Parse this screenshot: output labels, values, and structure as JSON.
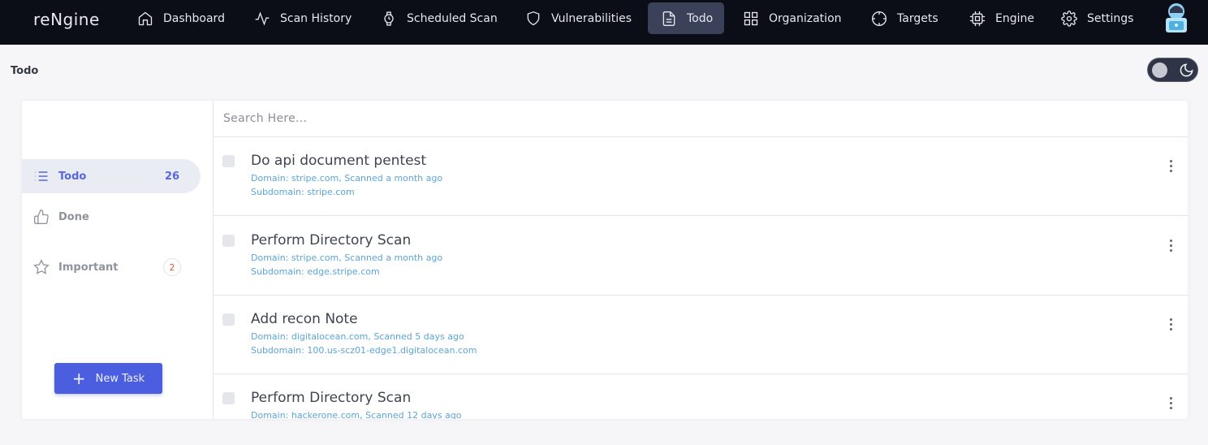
{
  "brand": "reNgine",
  "nav": {
    "items": [
      {
        "label": "Dashboard",
        "icon": "home-icon"
      },
      {
        "label": "Scan History",
        "icon": "activity-icon"
      },
      {
        "label": "Scheduled Scan",
        "icon": "watch-icon"
      },
      {
        "label": "Vulnerabilities",
        "icon": "shield-icon"
      },
      {
        "label": "Todo",
        "icon": "file-text-icon",
        "active": true
      },
      {
        "label": "Organization",
        "icon": "grid-icon"
      },
      {
        "label": "Targets",
        "icon": "crosshair-icon"
      },
      {
        "label": "Engine",
        "icon": "cpu-icon"
      },
      {
        "label": "Settings",
        "icon": "gear-icon"
      }
    ]
  },
  "page": {
    "title": "Todo"
  },
  "sidebar": {
    "items": [
      {
        "label": "Todo",
        "count": "26",
        "icon": "list-icon",
        "active": true
      },
      {
        "label": "Done",
        "icon": "thumbs-up-icon"
      },
      {
        "label": "Important",
        "count": "2",
        "icon": "star-icon"
      }
    ],
    "new_task_label": "New Task"
  },
  "search": {
    "placeholder": "Search Here..."
  },
  "tasks": [
    {
      "title": "Do api document pentest",
      "meta": "Domain: stripe.com, Scanned a month ago",
      "subdomain": "Subdomain: stripe.com"
    },
    {
      "title": "Perform Directory Scan",
      "meta": "Domain: stripe.com, Scanned a month ago",
      "subdomain": "Subdomain: edge.stripe.com"
    },
    {
      "title": "Add recon Note",
      "meta": "Domain: digitalocean.com, Scanned 5 days ago",
      "subdomain": "Subdomain: 100.us-scz01-edge1.digitalocean.com"
    },
    {
      "title": "Perform Directory Scan",
      "meta": "Domain: hackerone.com, Scanned 12 days ago",
      "subdomain": ""
    }
  ],
  "colors": {
    "navbar": "#0b0d17",
    "accent": "#5867dd",
    "button": "#4b5ee0",
    "meta_text": "#5aa6d8",
    "badge_text": "#e8543c"
  }
}
